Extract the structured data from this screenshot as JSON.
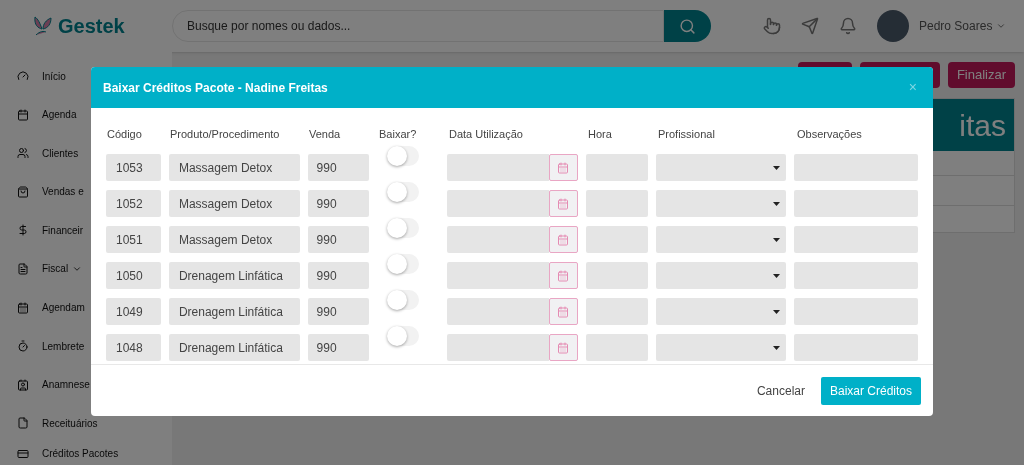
{
  "header": {
    "logo_text": "Gestek",
    "search": {
      "placeholder": "Busque por nomes ou dados..."
    },
    "user_name": "Pedro Soares"
  },
  "sidebar": {
    "items": [
      {
        "label": "Início",
        "kind": "link"
      },
      {
        "label": "Agenda",
        "kind": "link"
      },
      {
        "label": "Clientes",
        "kind": "link"
      },
      {
        "label": "Vendas e",
        "kind": "link"
      },
      {
        "label": "Financeir",
        "kind": "link"
      },
      {
        "label": "Fiscal",
        "kind": "group"
      },
      {
        "label": "Agendam",
        "kind": "link"
      },
      {
        "label": "Lembrete",
        "kind": "link"
      },
      {
        "label": "Anamnese",
        "kind": "link"
      },
      {
        "label": "Receituários",
        "kind": "link"
      },
      {
        "label": "Créditos Pacotes",
        "kind": "link"
      }
    ]
  },
  "main": {
    "finalize_button": "Finalizar",
    "card_title": "itas"
  },
  "modal": {
    "title": "Baixar Créditos Pacote - Nadine Freitas",
    "close": "×",
    "columns": [
      "Código",
      "Produto/Procedimento",
      "Venda",
      "Baixar?",
      "Data Utilização",
      "Hora",
      "Profissional",
      "Observações"
    ],
    "rows": [
      {
        "code": "1053",
        "product": "Massagem Detox",
        "price": "990",
        "baixar": false
      },
      {
        "code": "1052",
        "product": "Massagem Detox",
        "price": "990",
        "baixar": false
      },
      {
        "code": "1051",
        "product": "Massagem Detox",
        "price": "990",
        "baixar": false
      },
      {
        "code": "1050",
        "product": "Drenagem Linfática",
        "price": "990",
        "baixar": false
      },
      {
        "code": "1049",
        "product": "Drenagem Linfática",
        "price": "990",
        "baixar": false
      },
      {
        "code": "1048",
        "product": "Drenagem Linfática",
        "price": "990",
        "baixar": false
      }
    ],
    "cancel_button": "Cancelar",
    "confirm_button": "Baixar Créditos"
  }
}
